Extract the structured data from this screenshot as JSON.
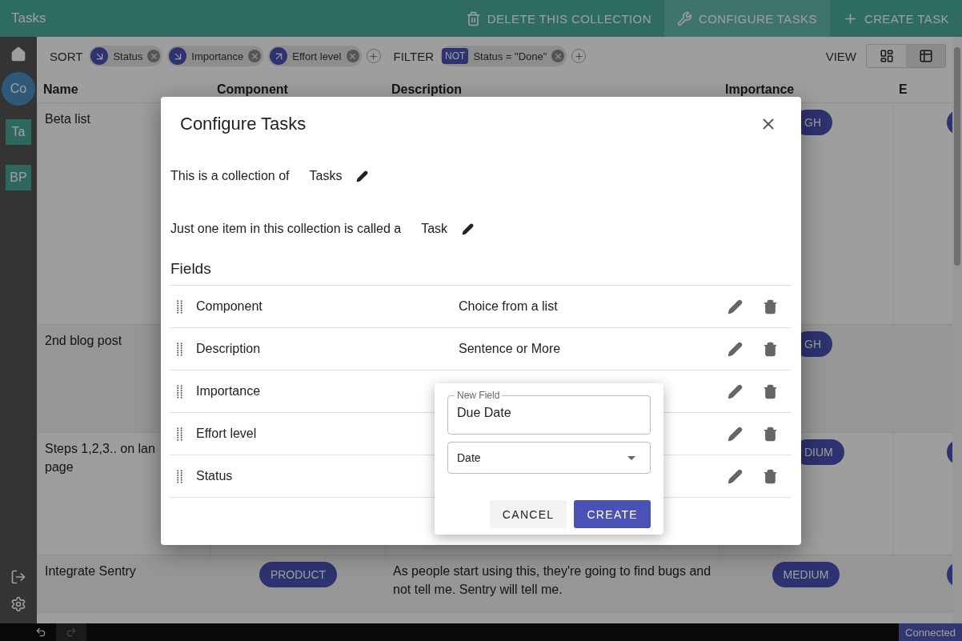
{
  "app_bar": {
    "title": "Tasks",
    "actions": [
      {
        "label": "DELETE THIS COLLECTION",
        "kind": "delete",
        "selected": false
      },
      {
        "label": "CONFIGURE TASKS",
        "kind": "configure",
        "selected": true
      },
      {
        "label": "CREATE TASK",
        "kind": "create",
        "selected": false
      }
    ]
  },
  "sidebar": {
    "top": [
      {
        "kind": "home"
      }
    ],
    "collections": [
      {
        "label": "Co",
        "selected": true
      },
      {
        "label": "Ta",
        "selected": false
      },
      {
        "label": "BP",
        "selected": false
      }
    ],
    "bottom": [
      {
        "kind": "logout"
      },
      {
        "kind": "settings"
      }
    ]
  },
  "toolbar": {
    "sort_label": "SORT",
    "sort_chips": [
      {
        "label": "Status",
        "kind": "descending"
      },
      {
        "label": "Importance",
        "kind": "descending"
      },
      {
        "label": "Effort level",
        "kind": "ascending"
      }
    ],
    "filter_label": "FILTER",
    "filter_chips": [
      {
        "tag": "NOT",
        "label": "Status = \"Done\""
      }
    ],
    "view_label": "VIEW",
    "view_options": [
      {
        "kind": "board",
        "selected": false
      },
      {
        "kind": "table",
        "selected": true
      }
    ]
  },
  "table": {
    "columns": [
      "Name",
      "Component",
      "Description",
      "Importance",
      "E"
    ],
    "rows": [
      {
        "name_lines": [
          "Beta list"
        ],
        "importance": {
          "label": "GH",
          "clipped": true
        },
        "effort_pill": true
      },
      {
        "name_lines": [
          "2nd blog post"
        ],
        "importance": {
          "label": "GH",
          "clipped": true
        },
        "effort_pill": false
      },
      {
        "name_lines": [
          "Steps 1,2,3.. on lan",
          "page"
        ],
        "importance": {
          "label": "DIUM",
          "clipped": true
        },
        "effort_pill": true
      },
      {
        "name_lines": [
          "Integrate Sentry"
        ],
        "component": "PRODUCT",
        "description": "As people start using this, they're going to find bugs and not tell me. Sentry will tell me.",
        "importance": {
          "label": "MEDIUM",
          "clipped": false
        },
        "effort_pill": true
      }
    ]
  },
  "dialog": {
    "title": "Configure Tasks",
    "lines": [
      {
        "text": "This is a collection of",
        "value": "Tasks"
      },
      {
        "text": "Just one item in this collection is called a",
        "value": "Task"
      }
    ],
    "fields_heading": "Fields",
    "fields": [
      {
        "name": "Component",
        "type": "Choice from a list"
      },
      {
        "name": "Description",
        "type": "Sentence or More"
      },
      {
        "name": "Importance"
      },
      {
        "name": "Effort level"
      },
      {
        "name": "Status"
      }
    ],
    "popover": {
      "field_label": "New Field",
      "field_value": "Due Date",
      "type_value": "Date",
      "cancel": "CANCEL",
      "create": "CREATE"
    }
  },
  "status_bar": {
    "undo_disabled": false,
    "redo_disabled": true,
    "connection": "Connected"
  }
}
